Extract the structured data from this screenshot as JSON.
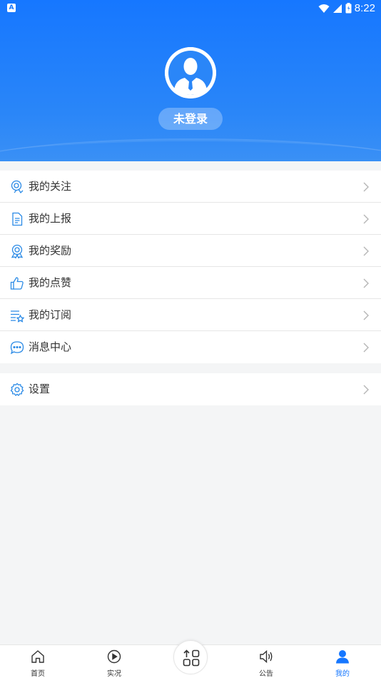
{
  "status_bar": {
    "time": "8:22",
    "app_badge": "A"
  },
  "profile": {
    "login_label": "未登录"
  },
  "menu_group1": [
    {
      "label": "我的关注",
      "icon": "follow-icon"
    },
    {
      "label": "我的上报",
      "icon": "document-icon"
    },
    {
      "label": "我的奖励",
      "icon": "award-icon"
    },
    {
      "label": "我的点赞",
      "icon": "thumbs-up-icon"
    },
    {
      "label": "我的订阅",
      "icon": "subscribe-icon"
    },
    {
      "label": "消息中心",
      "icon": "message-icon"
    }
  ],
  "menu_group2": [
    {
      "label": "设置",
      "icon": "gear-icon"
    }
  ],
  "bottom_nav": [
    {
      "label": "首页",
      "icon": "home-icon"
    },
    {
      "label": "实况",
      "icon": "play-icon"
    },
    {
      "label": "",
      "icon": "apps-upload-icon"
    },
    {
      "label": "公告",
      "icon": "speaker-icon"
    },
    {
      "label": "我的",
      "icon": "person-icon",
      "active": true
    }
  ],
  "colors": {
    "accent": "#1677ff",
    "icon_blue": "#2a8ae6"
  }
}
